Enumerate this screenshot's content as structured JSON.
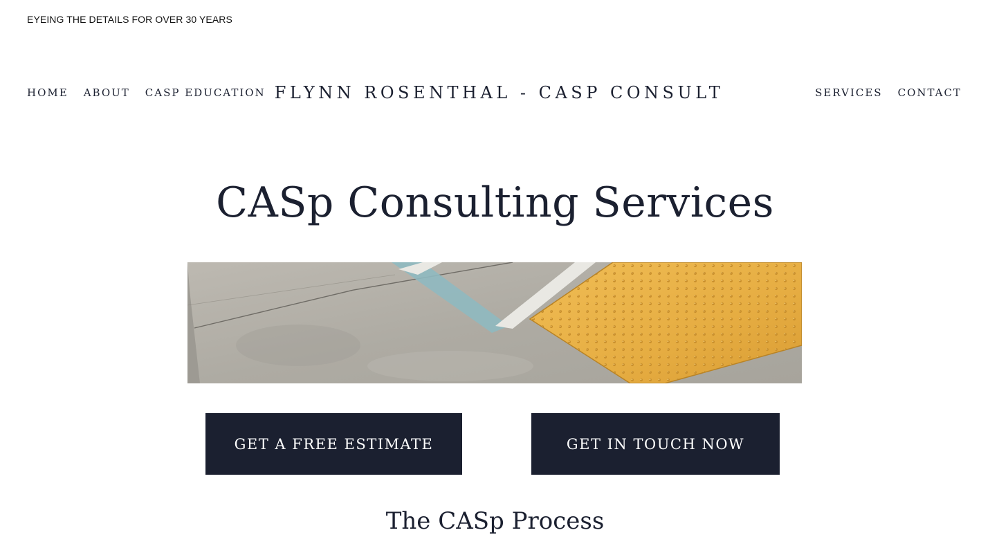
{
  "announcement_bar": {
    "text": "EYEING THE DETAILS FOR OVER 30 YEARS"
  },
  "header": {
    "site_title": "FLYNN ROSENTHAL - CASP CONSULT",
    "nav_left": [
      {
        "label": "HOME"
      },
      {
        "label": "ABOUT"
      },
      {
        "label": "CASP EDUCATION"
      }
    ],
    "nav_right": [
      {
        "label": "SERVICES"
      },
      {
        "label": "CONTACT"
      }
    ]
  },
  "main": {
    "heading": "CASp Consulting Services",
    "hero_image": {
      "alt": "Concrete parking area with blue and white painted lines and a yellow truncated-dome detectable warning pad"
    },
    "buttons": {
      "estimate_label": "GET A FREE ESTIMATE",
      "touch_label": "GET IN TOUCH NOW"
    },
    "section_heading": "The CASp Process"
  },
  "colors": {
    "text": "#1b2030",
    "button_bg": "#1b2030",
    "button_text": "#ffffff",
    "background": "#ffffff",
    "warning_pad": "#e8b045"
  }
}
